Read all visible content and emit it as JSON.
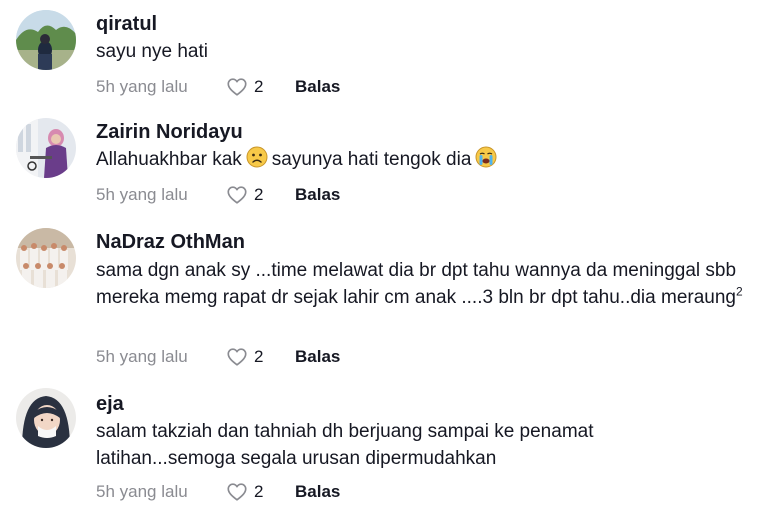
{
  "comments": [
    {
      "username": "qiratul",
      "text": "sayu nye hati",
      "time": "5h yang lalu",
      "likes": "2",
      "reply_label": "Balas"
    },
    {
      "username": "Zairin Noridayu",
      "text_part1": "Allahuakhbar kak",
      "text_part2": "sayunya hati tengok dia",
      "emoji1": "worried-face",
      "emoji2": "loudly-crying-face",
      "time": "5h yang lalu",
      "likes": "2",
      "reply_label": "Balas"
    },
    {
      "username": "NaDraz OthMan",
      "text": "sama dgn anak sy ...time melawat dia br dpt tahu wannya da meninggal sbb mereka memg rapat dr sejak lahir cm anak ....3 bln br dpt tahu..dia meraung",
      "superscript": "2",
      "time": "5h yang lalu",
      "likes": "2",
      "reply_label": "Balas"
    },
    {
      "username": "eja",
      "text": "salam takziah dan tahniah dh berjuang sampai ke penamat latihan...semoga segala urusan dipermudahkan",
      "time": "5h yang lalu",
      "likes": "2",
      "reply_label": "Balas"
    }
  ],
  "icons": {
    "like": "heart-outline-icon"
  },
  "colors": {
    "text": "#161823",
    "muted": "#8a8b91"
  }
}
